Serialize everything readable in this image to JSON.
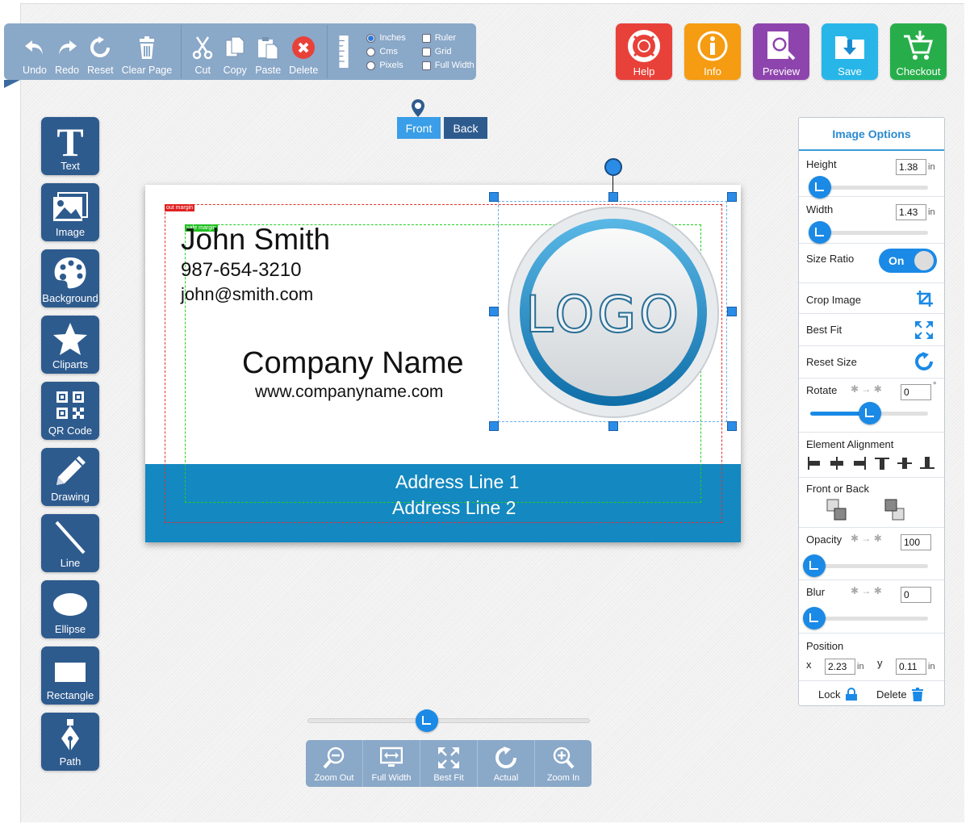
{
  "toolbar": {
    "undo": "Undo",
    "redo": "Redo",
    "reset": "Reset",
    "clear_page": "Clear Page",
    "cut": "Cut",
    "copy": "Copy",
    "paste": "Paste",
    "delete": "Delete",
    "units": {
      "inches": "Inches",
      "cms": "Cms",
      "pixels": "Pixels",
      "selected": "Inches"
    },
    "toggles": {
      "ruler": "Ruler",
      "grid": "Grid",
      "full_width": "Full Width"
    }
  },
  "top_actions": {
    "help": "Help",
    "info": "Info",
    "preview": "Preview",
    "save": "Save",
    "checkout": "Checkout"
  },
  "colors": {
    "help": "#e8413a",
    "info": "#f59c12",
    "preview": "#8e44ad",
    "save": "#28b6e8",
    "checkout": "#27ae4a",
    "tool": "#2e5b8e",
    "accent": "#1a8ae6",
    "band": "#1488c0"
  },
  "sidebar": {
    "text": "Text",
    "image": "Image",
    "background": "Background",
    "cliparts": "Cliparts",
    "qr_code": "QR Code",
    "drawing": "Drawing",
    "line": "Line",
    "ellipse": "Ellipse",
    "rectangle": "Rectangle",
    "path": "Path"
  },
  "sides": {
    "front": "Front",
    "back": "Back",
    "active": "Front"
  },
  "card": {
    "name": "John Smith",
    "phone": "987-654-3210",
    "email": "john@smith.com",
    "company": "Company Name",
    "website": "www.companyname.com",
    "address1": "Address Line 1",
    "address2": "Address Line 2",
    "logo_text": "LOGO",
    "out_margin": "out margin",
    "safe_margin": "safe margin"
  },
  "panel": {
    "title": "Image Options",
    "height_label": "Height",
    "height_value": "1.38",
    "height_unit": "in",
    "width_label": "Width",
    "width_value": "1.43",
    "width_unit": "in",
    "size_ratio_label": "Size Ratio",
    "size_ratio_state": "On",
    "crop_label": "Crop Image",
    "best_fit_label": "Best Fit",
    "reset_size_label": "Reset Size",
    "rotate_label": "Rotate",
    "rotate_value": "0",
    "rotate_unit": "°",
    "alignment_label": "Element Alignment",
    "front_back_label": "Front or Back",
    "opacity_label": "Opacity",
    "opacity_value": "100",
    "blur_label": "Blur",
    "blur_value": "0",
    "position_label": "Position",
    "x_label": "x",
    "x_value": "2.23",
    "x_unit": "in",
    "y_label": "y",
    "y_value": "0.11",
    "y_unit": "in",
    "lock_label": "Lock",
    "delete_label": "Delete"
  },
  "zoom": {
    "zoom_out": "Zoom Out",
    "full_width": "Full Width",
    "best_fit": "Best Fit",
    "actual": "Actual",
    "zoom_in": "Zoom In"
  }
}
